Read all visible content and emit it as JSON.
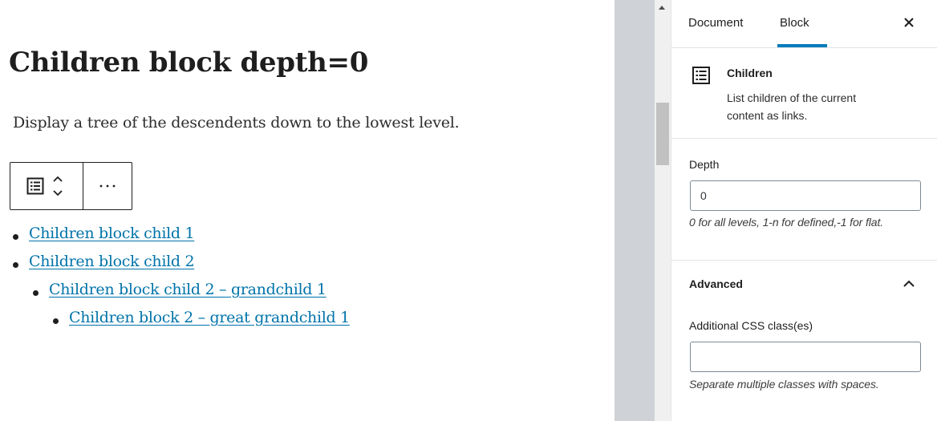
{
  "editor": {
    "title": "Children block depth=0",
    "description": "Display a tree of the descendents down to the lowest level.",
    "toolbar": {
      "block_icon": "list-view-icon",
      "move_up_icon": "chevron-up-icon",
      "move_down_icon": "chevron-down-icon",
      "more_label": "⋯"
    },
    "children_tree": [
      {
        "label": "Children block child 1",
        "level": 0
      },
      {
        "label": "Children block child 2",
        "level": 0
      },
      {
        "label": "Children block child 2 – grandchild 1",
        "level": 1
      },
      {
        "label": "Children block 2 – great grandchild 1",
        "level": 2
      }
    ]
  },
  "sidebar": {
    "tabs": [
      {
        "label": "Document",
        "active": false
      },
      {
        "label": "Block",
        "active": true
      }
    ],
    "close_icon": "close-icon",
    "block_card": {
      "icon": "list-view-icon",
      "title": "Children",
      "description": "List children of the current content as links."
    },
    "depth": {
      "label": "Depth",
      "value": "0",
      "help": "0 for all levels, 1-n for defined,-1 for flat."
    },
    "advanced": {
      "title": "Advanced",
      "expanded": true,
      "css_label": "Additional CSS class(es)",
      "css_value": "",
      "css_help": "Separate multiple classes with spaces."
    }
  },
  "colors": {
    "link": "#0073aa",
    "accent": "#007cba",
    "scrollbar_track": "#cfd3d7",
    "text": "#1e1e1e"
  }
}
